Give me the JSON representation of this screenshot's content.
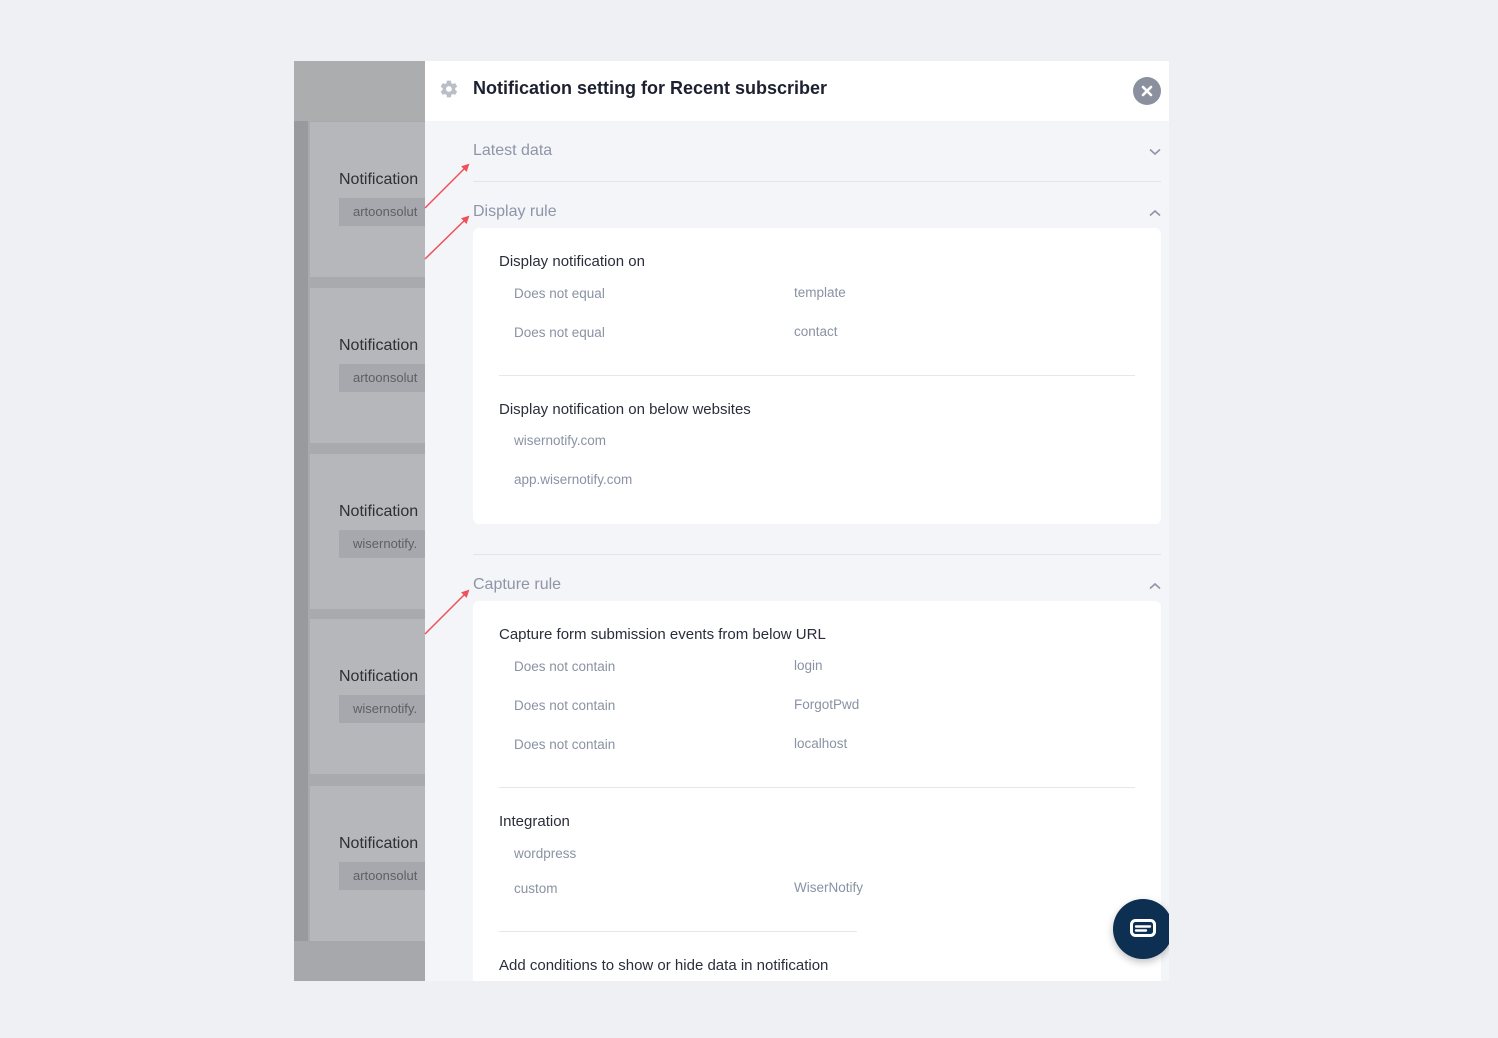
{
  "background_cards": [
    {
      "title": "Notification",
      "chip": "artoonsolut"
    },
    {
      "title": "Notification",
      "chip": "artoonsolut"
    },
    {
      "title": "Notification",
      "chip": "wisernotify."
    },
    {
      "title": "Notification",
      "chip": "wisernotify."
    },
    {
      "title": "Notification",
      "chip": "artoonsolut"
    }
  ],
  "panel": {
    "title": "Notification setting for Recent subscriber",
    "header_icon": "gear-icon",
    "close_icon": "close-icon"
  },
  "sections": {
    "latest_data": {
      "label": "Latest data",
      "expanded": false
    },
    "display_rule": {
      "label": "Display rule",
      "expanded": true,
      "display_on": {
        "heading": "Display notification on",
        "rows": [
          {
            "condition": "Does not equal",
            "value": "template"
          },
          {
            "condition": "Does not equal",
            "value": "contact"
          }
        ]
      },
      "websites": {
        "heading": "Display notification on below websites",
        "items": [
          "wisernotify.com",
          "app.wisernotify.com"
        ]
      }
    },
    "capture_rule": {
      "label": "Capture rule",
      "expanded": true,
      "capture_url": {
        "heading": "Capture form submission events from below URL",
        "rows": [
          {
            "condition": "Does not contain",
            "value": "login"
          },
          {
            "condition": "Does not contain",
            "value": "ForgotPwd"
          },
          {
            "condition": "Does not contain",
            "value": "localhost"
          }
        ]
      },
      "integration": {
        "heading": "Integration",
        "items": [
          {
            "name": "wordpress",
            "value": ""
          },
          {
            "name": "custom",
            "value": "WiserNotify"
          }
        ]
      },
      "conditions_heading": "Add conditions to show or hide data in notification"
    }
  },
  "colors": {
    "annotation_arrow": "#f0505a",
    "chat_button": "#0d2f52",
    "section_label": "#8e95a8"
  },
  "chat_icon": "chat-icon"
}
